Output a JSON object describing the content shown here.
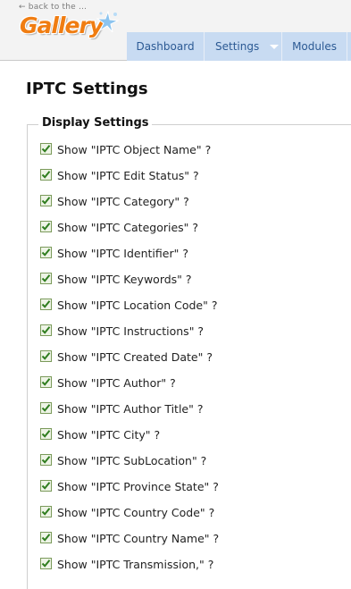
{
  "header": {
    "back_link": "← back to the ...",
    "logo_text": "Gallery",
    "colors": {
      "logo": "#f07d12",
      "tab_bg": "#c8dbf2",
      "tab_text": "#2c5a94"
    }
  },
  "nav": {
    "tabs": [
      {
        "label": "Dashboard"
      },
      {
        "label": "Settings"
      },
      {
        "label": "Modules"
      }
    ]
  },
  "page": {
    "title": "IPTC Settings",
    "fieldset_legend": "Display Settings"
  },
  "settings": [
    {
      "label": "Show \"IPTC Object Name\" ?",
      "checked": true
    },
    {
      "label": "Show \"IPTC Edit Status\" ?",
      "checked": true
    },
    {
      "label": "Show \"IPTC Category\" ?",
      "checked": true
    },
    {
      "label": "Show \"IPTC Categories\" ?",
      "checked": true
    },
    {
      "label": "Show \"IPTC Identifier\" ?",
      "checked": true
    },
    {
      "label": "Show \"IPTC Keywords\" ?",
      "checked": true
    },
    {
      "label": "Show \"IPTC Location Code\" ?",
      "checked": true
    },
    {
      "label": "Show \"IPTC Instructions\" ?",
      "checked": true
    },
    {
      "label": "Show \"IPTC Created Date\" ?",
      "checked": true
    },
    {
      "label": "Show \"IPTC Author\" ?",
      "checked": true
    },
    {
      "label": "Show \"IPTC Author Title\" ?",
      "checked": true
    },
    {
      "label": "Show \"IPTC City\" ?",
      "checked": true
    },
    {
      "label": "Show \"IPTC SubLocation\" ?",
      "checked": true
    },
    {
      "label": "Show \"IPTC Province State\" ?",
      "checked": true
    },
    {
      "label": "Show \"IPTC Country Code\" ?",
      "checked": true
    },
    {
      "label": "Show \"IPTC Country Name\" ?",
      "checked": true
    },
    {
      "label": "Show \"IPTC Transmission,\" ?",
      "checked": true
    }
  ]
}
